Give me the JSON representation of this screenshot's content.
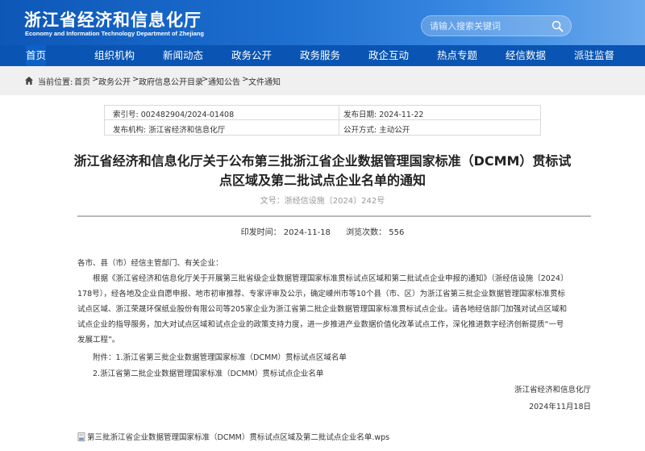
{
  "header": {
    "site_name": "浙江省经济和信息化厅",
    "site_name_en": "Economy and Information Technology Department of Zhejiang",
    "search_placeholder": "请输入搜索关键词",
    "search_icon": "search-icon"
  },
  "nav": {
    "items": [
      "首页",
      "组织机构",
      "新闻动态",
      "政务公开",
      "政务服务",
      "政企互动",
      "热点专题",
      "经信数据",
      "派驻监督"
    ],
    "active_index": 0
  },
  "breadcrumb": {
    "label": "当前位置:",
    "items": [
      "首页",
      "政务公开",
      "政府信息公开目录",
      "通知公告",
      "文件通知"
    ],
    "separator": ">"
  },
  "meta": {
    "index_no": "索引号: 002482904/2024-01408",
    "issue_date": "发布日期: 2024-11-22",
    "publisher": "发布机构: 浙江省经济和信息化厅",
    "open_mode": "公开方式: 主动公开"
  },
  "article": {
    "title_line1": "浙江省经济和信息化厅关于公布第三批浙江省企业数据管理国家标准（DCMM）贯标试",
    "title_line2": "点区域及第二批试点企业名单的通知",
    "doc_number": "文号：浙经信设施〔2024〕242号",
    "print_time": "印发时间： 2024-11-18",
    "view_count": "浏览次数： 556",
    "body_lines": [
      "各市、县（市）经信主管部门、有关企业：",
      "　　根据《浙江省经济和信息化厅关于开展第三批省级企业数据管理国家标准贯标试点区域和第二批试点企业申报的通知》（浙经信设施〔2024〕",
      "178号），经各地及企业自愿申报、地市初审推荐、专家评审及公示，确定嵊州市等10个县（市、区）为浙江省第三批企业数据管理国家标准贯标",
      "试点区域、浙江荣晟环保纸业股份有限公司等205家企业为浙江省第二批企业数据管理国家标准贯标试点企业。请各地经信部门加强对试点区域和",
      "试点企业的指导服务，加大对试点区域和试点企业的政策支持力度，进一步推进产业数据价值化改革试点工作，深化推进数字经济创新提质“一号",
      "发展工程”。",
      "　　附件：1.浙江省第三批企业数据管理国家标准（DCMM）贯标试点区域名单",
      "　　2.浙江省第二批企业数据管理国家标准（DCMM）贯标试点企业名单"
    ],
    "signature": "浙江省经济和信息化厅",
    "sign_date": "2024年11月18日",
    "attachment_file": "第三批浙江省企业数据管理国家标准（DCMM）贯标试点区域及第二批试点企业名单.wps"
  },
  "colors": {
    "header_blue": "#0d57b7",
    "nav_blue": "#0a55b3",
    "breadcrumb_bg": "#f0f0f0"
  }
}
